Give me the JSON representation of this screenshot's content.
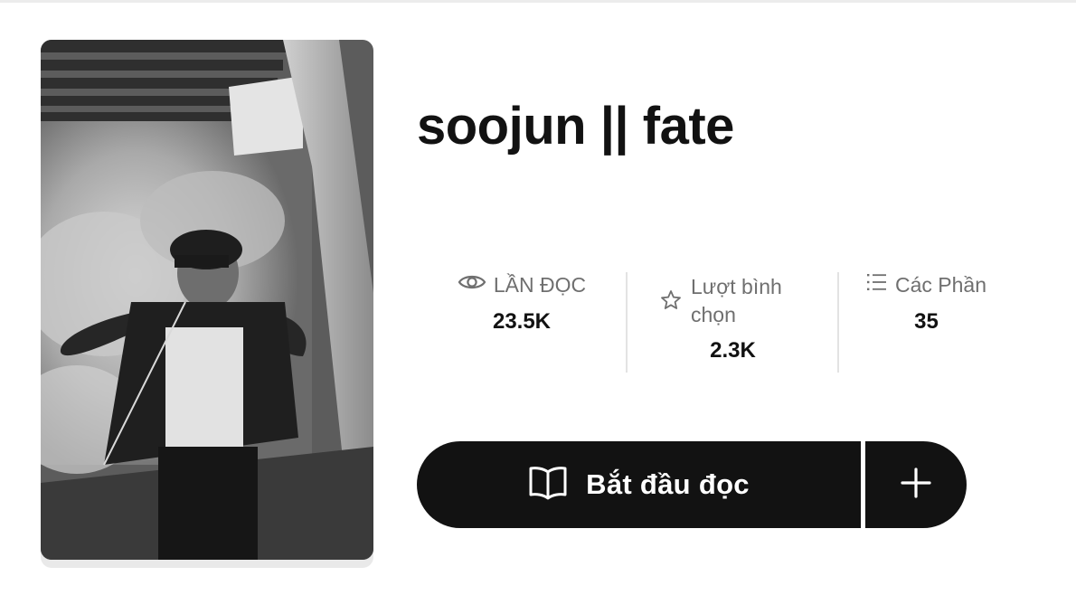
{
  "story": {
    "title": "soojun || fate",
    "cover_alt": "Book cover"
  },
  "stats": {
    "reads": {
      "label": "LẦN ĐỌC",
      "value": "23.5K",
      "icon": "eye-icon"
    },
    "votes": {
      "label": "Lượt bình chọn",
      "value": "2.3K",
      "icon": "star-icon"
    },
    "parts": {
      "label": "Các Phần",
      "value": "35",
      "icon": "list-icon"
    }
  },
  "actions": {
    "start_label": "Bắt đầu đọc",
    "start_icon": "open-book-icon",
    "add_icon": "plus-icon"
  },
  "colors": {
    "primary": "#121212",
    "muted_text": "#6f6f6f",
    "divider": "#e3e3e3"
  }
}
